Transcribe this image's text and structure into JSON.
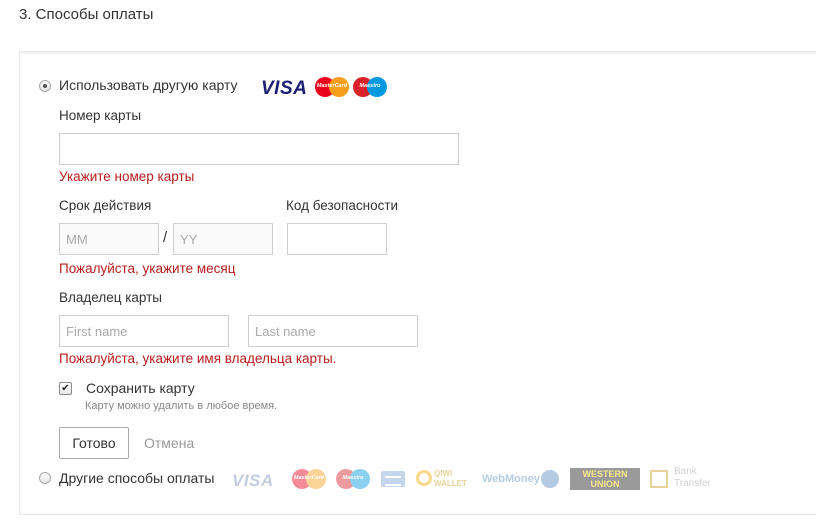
{
  "section": {
    "title": "3. Способы оплаты"
  },
  "card_option": {
    "label": "Использовать другую карту",
    "selected": true,
    "brands": {
      "visa": "VISA",
      "mastercard": "MasterCard",
      "maestro": "Maestro"
    }
  },
  "card_number": {
    "label": "Номер карты",
    "value": "",
    "placeholder": "",
    "error": "Укажите номер карты"
  },
  "expiry": {
    "label": "Срок действия",
    "month_placeholder": "MM",
    "separator": "/",
    "year_placeholder": "YY",
    "error": "Пожалуйста, укажите месяц"
  },
  "cvv": {
    "label": "Код безопасности",
    "value": ""
  },
  "holder": {
    "label": "Владелец карты",
    "first_placeholder": "First name",
    "last_placeholder": "Last name",
    "error": "Пожалуйста, укажите имя владельца карты."
  },
  "save_card": {
    "checked": true,
    "check_glyph": "✔",
    "label": "Сохранить карту",
    "hint": "Карту можно удалить в любое время."
  },
  "actions": {
    "done": "Готово",
    "cancel": "Отмена"
  },
  "other_option": {
    "label": "Другие способы оплаты",
    "selected": false,
    "logos": {
      "visa": "VISA",
      "mastercard": "MasterCard",
      "maestro": "Maestro",
      "qiwi_1": "QIWI",
      "qiwi_2": "WALLET",
      "webmoney": "WebMoney",
      "western_1": "WESTERN",
      "western_2": "UNION",
      "bank_1": "Bank",
      "bank_2": "Transfer"
    }
  },
  "colors": {
    "error": "#b71c1c",
    "visa": "#1a1f71",
    "mc_red": "#eb001b",
    "mc_orange": "#f79e1b",
    "maestro_blue": "#0099df"
  }
}
